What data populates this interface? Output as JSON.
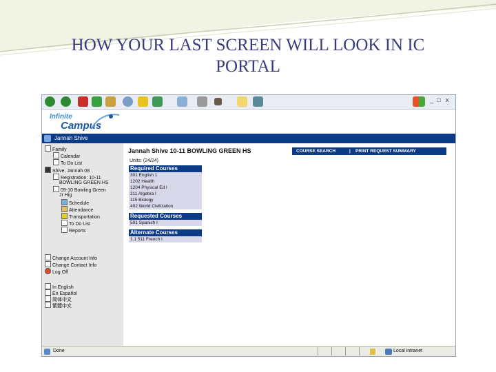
{
  "slide": {
    "title": "HOW YOUR LAST SCREEN WILL LOOK IN IC PORTAL",
    "accent": "#3a3a7a"
  },
  "browser": {
    "toolbar_icons": [
      "back-icon",
      "forward-icon",
      "stop-icon",
      "refresh-icon",
      "home-icon",
      "search-icon",
      "favorites-icon",
      "history-icon",
      "mail-icon",
      "print-icon",
      "edit-icon",
      "discuss-icon",
      "messenger-icon"
    ],
    "window_controls": [
      "_",
      "□",
      "x"
    ],
    "status_left": "Done",
    "status_right": "Local intranet"
  },
  "app": {
    "logo_line1": "Infinite",
    "logo_line2": "Campus",
    "user_name": "Jannah Shive",
    "brand_color": "#0b3b86"
  },
  "sidebar": {
    "items": [
      {
        "label": "Family"
      },
      {
        "label": "Calendar"
      },
      {
        "label": "To Do List"
      },
      {
        "label": "Shive, Jannah 08"
      },
      {
        "label": "Registration: 10-11"
      },
      {
        "label": "BOWLING GREEN HS"
      },
      {
        "label": "09-10 Bowling Green"
      },
      {
        "label": "Jr Hig"
      },
      {
        "label": "Schedule"
      },
      {
        "label": "Attendance"
      },
      {
        "label": "Transportation"
      },
      {
        "label": "To Do List"
      },
      {
        "label": "Reports"
      },
      {
        "label": "Change Account Info"
      },
      {
        "label": "Change Contact Info"
      },
      {
        "label": "Log Off"
      },
      {
        "label": "In English"
      },
      {
        "label": "En Español"
      },
      {
        "label": "简体中文"
      },
      {
        "label": "繁體中文"
      }
    ]
  },
  "main": {
    "student_header": "Jannah Shive     10-11 BOWLING GREEN HS",
    "nav": {
      "course_search": "COURSE SEARCH",
      "separator": "|",
      "print_summary": "PRINT REQUEST SUMMARY"
    },
    "units": "Units: (24/24)",
    "required": {
      "title": "Required Courses",
      "rows": [
        "301 English 1",
        "1202 Health",
        "1204 Physical Ed I",
        "211 Algebra I",
        "115 Biology",
        "402 World Civilization"
      ]
    },
    "requested": {
      "title": "Requested Courses",
      "rows": [
        "501 Spanish I"
      ]
    },
    "alternate": {
      "title": "Alternate Courses",
      "rows": [
        "1.1 511 French I"
      ]
    }
  }
}
